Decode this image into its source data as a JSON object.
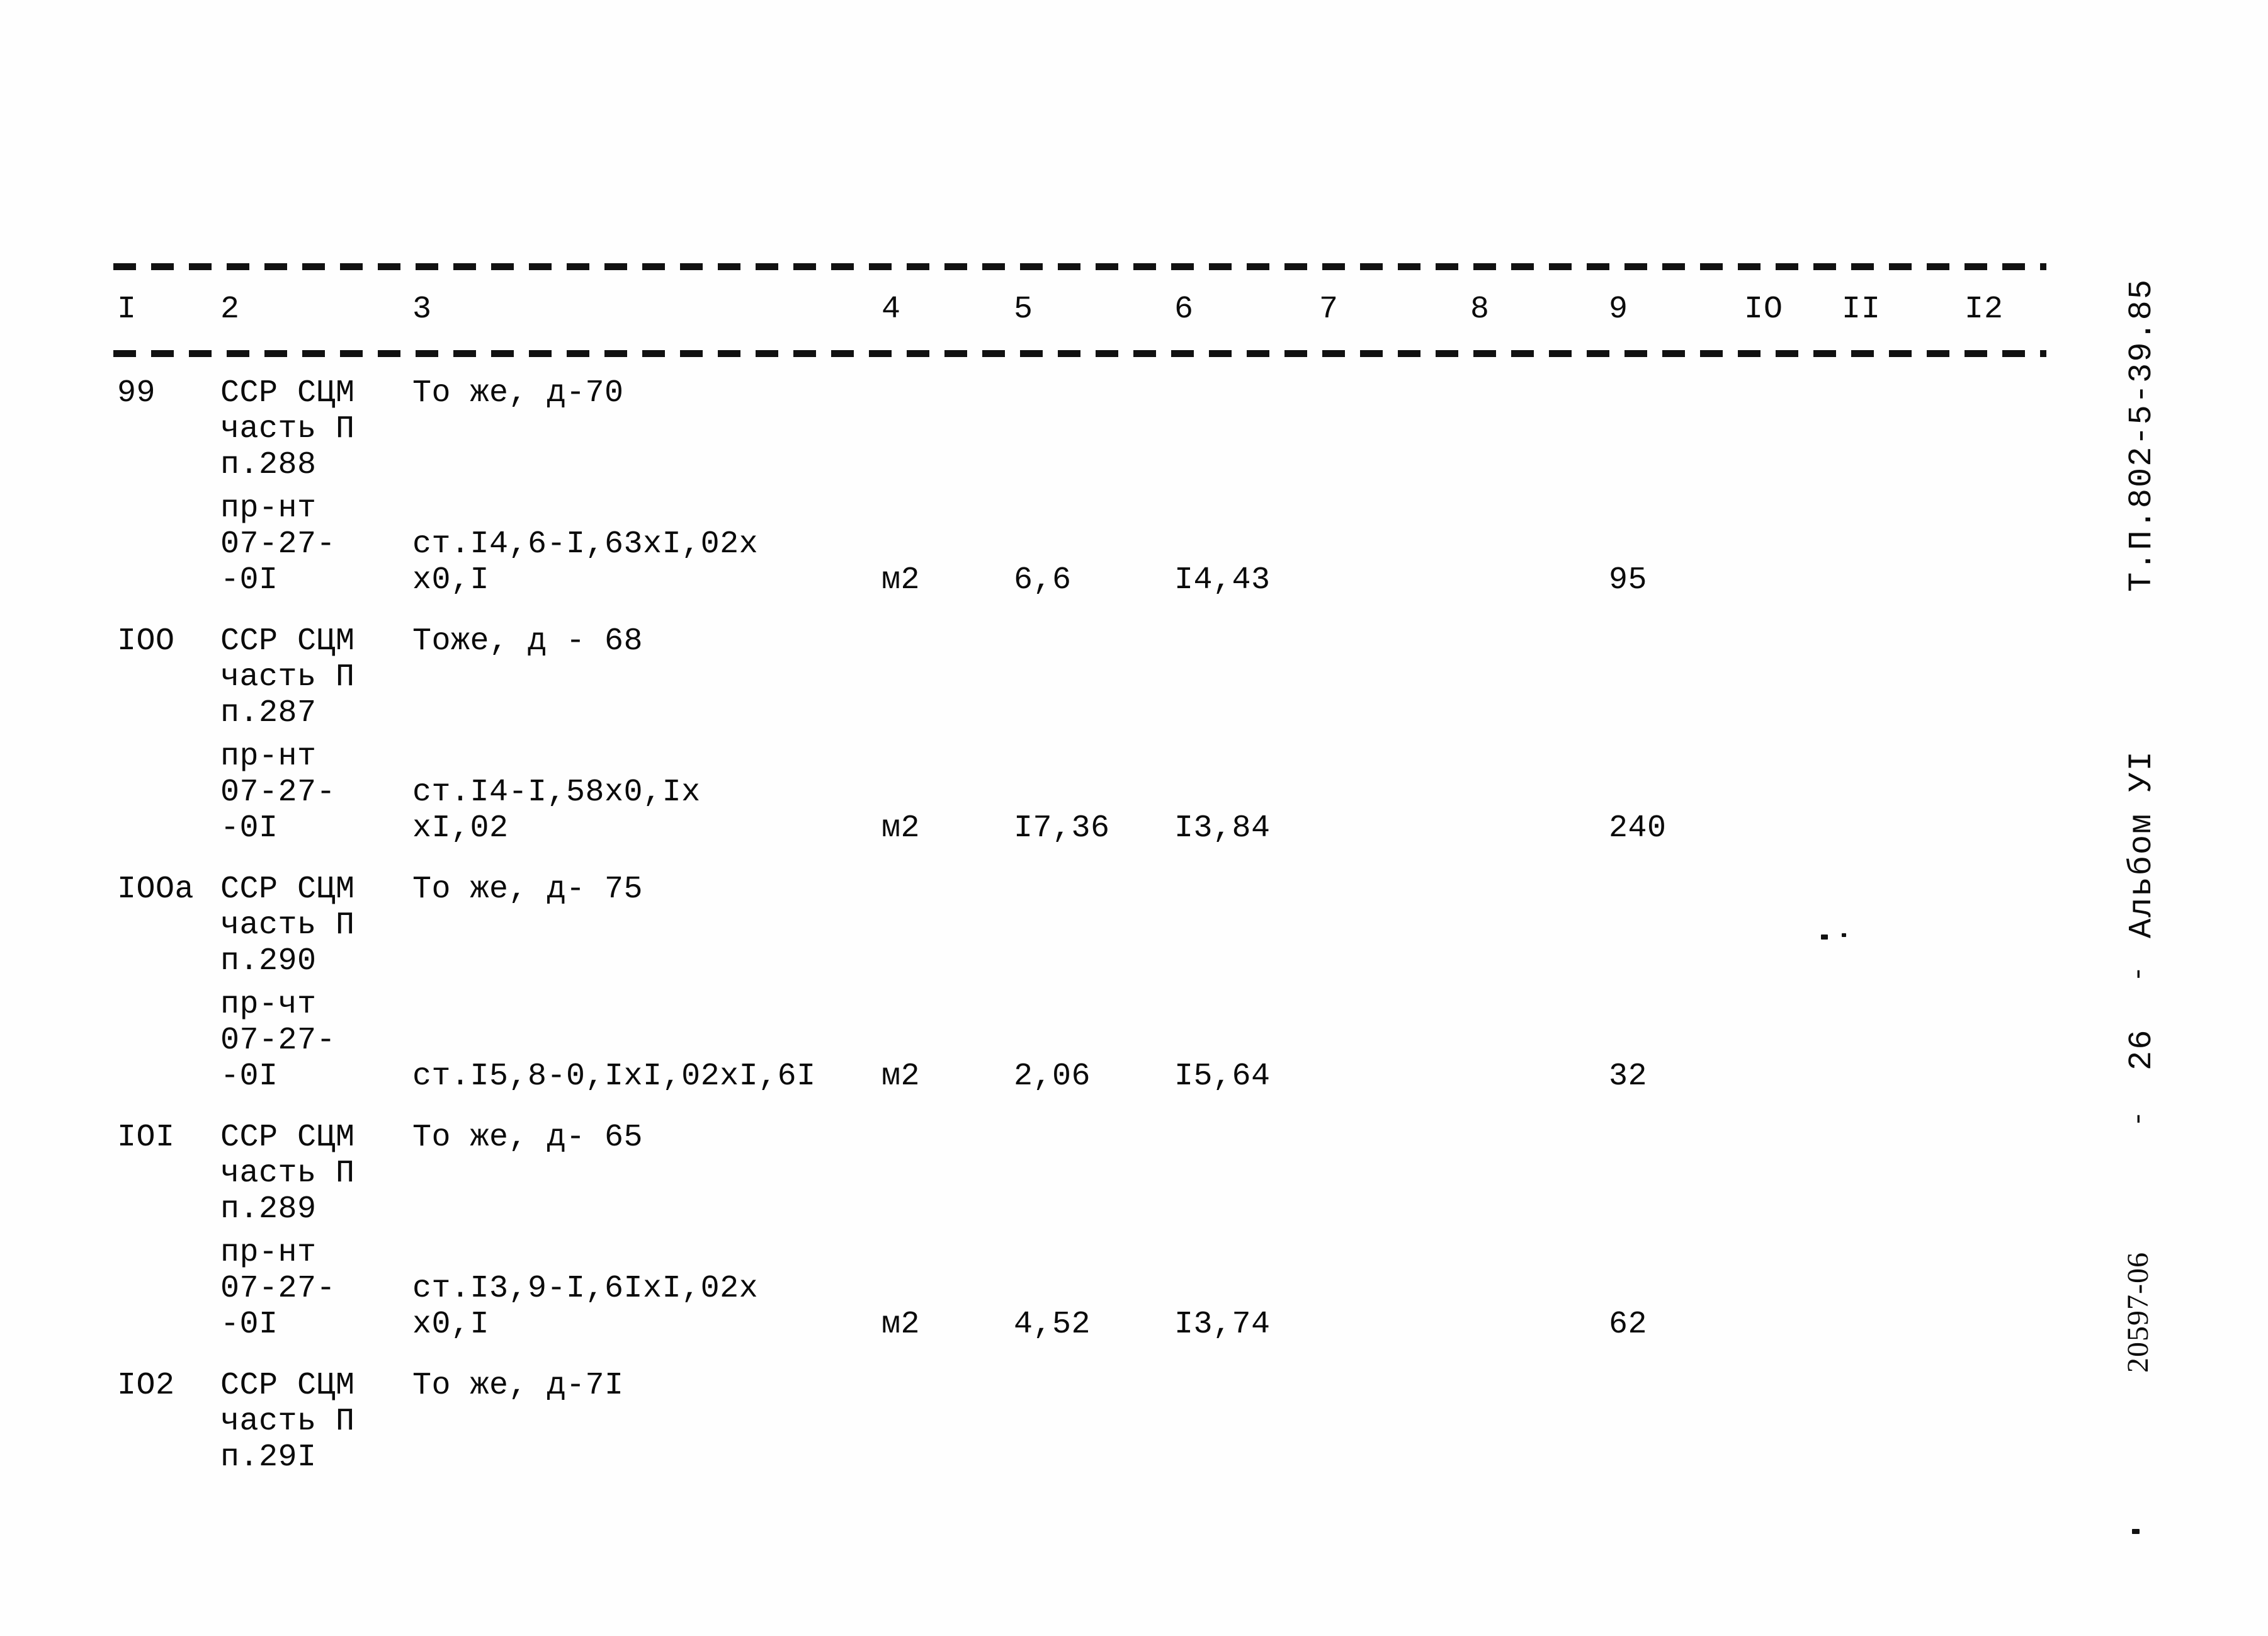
{
  "document": {
    "type": "typewritten-specification-table",
    "ink_color": "#0b0b0b",
    "paper_color": "#fefefe"
  },
  "margin_stamps": {
    "project_code": "Т.П.802-5-39.85",
    "album": "Альбом УI",
    "dash_before_page": "-",
    "page_number": "26",
    "dash_after_page": "-",
    "archive_code": "20597-06"
  },
  "table": {
    "column_headers": [
      "I",
      "2",
      "3",
      "4",
      "5",
      "6",
      "7",
      "8",
      "9",
      "IO",
      "II",
      "I2"
    ],
    "rows": [
      {
        "id": "row-99",
        "lines": [
          {
            "c1": "99",
            "c2": "ССР СЦМ",
            "c3": "То же, д-70"
          },
          {
            "c2": "часть П"
          },
          {
            "c2": "п.288"
          },
          {
            "c2": "пр-нт"
          },
          {
            "c2": "07-27-",
            "c3": "ст.I4,6-I,63xI,02x"
          },
          {
            "c2": "-0I",
            "c3": "х0,I",
            "c4": "м2",
            "c5": "6,6",
            "c6": "I4,43",
            "c9": "95"
          }
        ]
      },
      {
        "id": "row-100",
        "lines": [
          {
            "c1": "IOO",
            "c2": "ССР СЦМ",
            "c3": "Тоже, д - 68"
          },
          {
            "c2": "часть П"
          },
          {
            "c2": "п.287"
          },
          {
            "c2": "пр-нт"
          },
          {
            "c2": "07-27-",
            "c3": "ст.I4-I,58х0,Iх"
          },
          {
            "c2": "-0I",
            "c3": "хI,02",
            "c4": "м2",
            "c5": "I7,36",
            "c6": "I3,84",
            "c9": "240"
          }
        ]
      },
      {
        "id": "row-100a",
        "lines": [
          {
            "c1": "IOOа",
            "c2": "ССР СЦМ",
            "c3": "То же, д- 75"
          },
          {
            "c2": "часть П"
          },
          {
            "c2": "п.290"
          },
          {
            "c2": "пр-чт"
          },
          {
            "c2": "07-27-"
          },
          {
            "c2": "-0I",
            "c3": "ст.I5,8-0,IхI,02хI,6I",
            "c4": "м2",
            "c5": "2,06",
            "c6": "I5,64",
            "c9": "32"
          }
        ]
      },
      {
        "id": "row-101",
        "lines": [
          {
            "c1": "IOI",
            "c2": "ССР СЦМ",
            "c3": "То же, д- 65"
          },
          {
            "c2": "часть П"
          },
          {
            "c2": "п.289"
          },
          {
            "c2": "пр-нт"
          },
          {
            "c2": "07-27-",
            "c3": "ст.I3,9-I,6IхI,02х"
          },
          {
            "c2": "-0I",
            "c3": "х0,I",
            "c4": "м2",
            "c5": "4,52",
            "c6": "I3,74",
            "c9": "62"
          }
        ]
      },
      {
        "id": "row-102",
        "lines": [
          {
            "c1": "IO2",
            "c2": "ССР СЦМ",
            "c3": "То же, д-7I"
          },
          {
            "c2": "часть П"
          },
          {
            "c2": "п.29I"
          }
        ]
      }
    ]
  }
}
